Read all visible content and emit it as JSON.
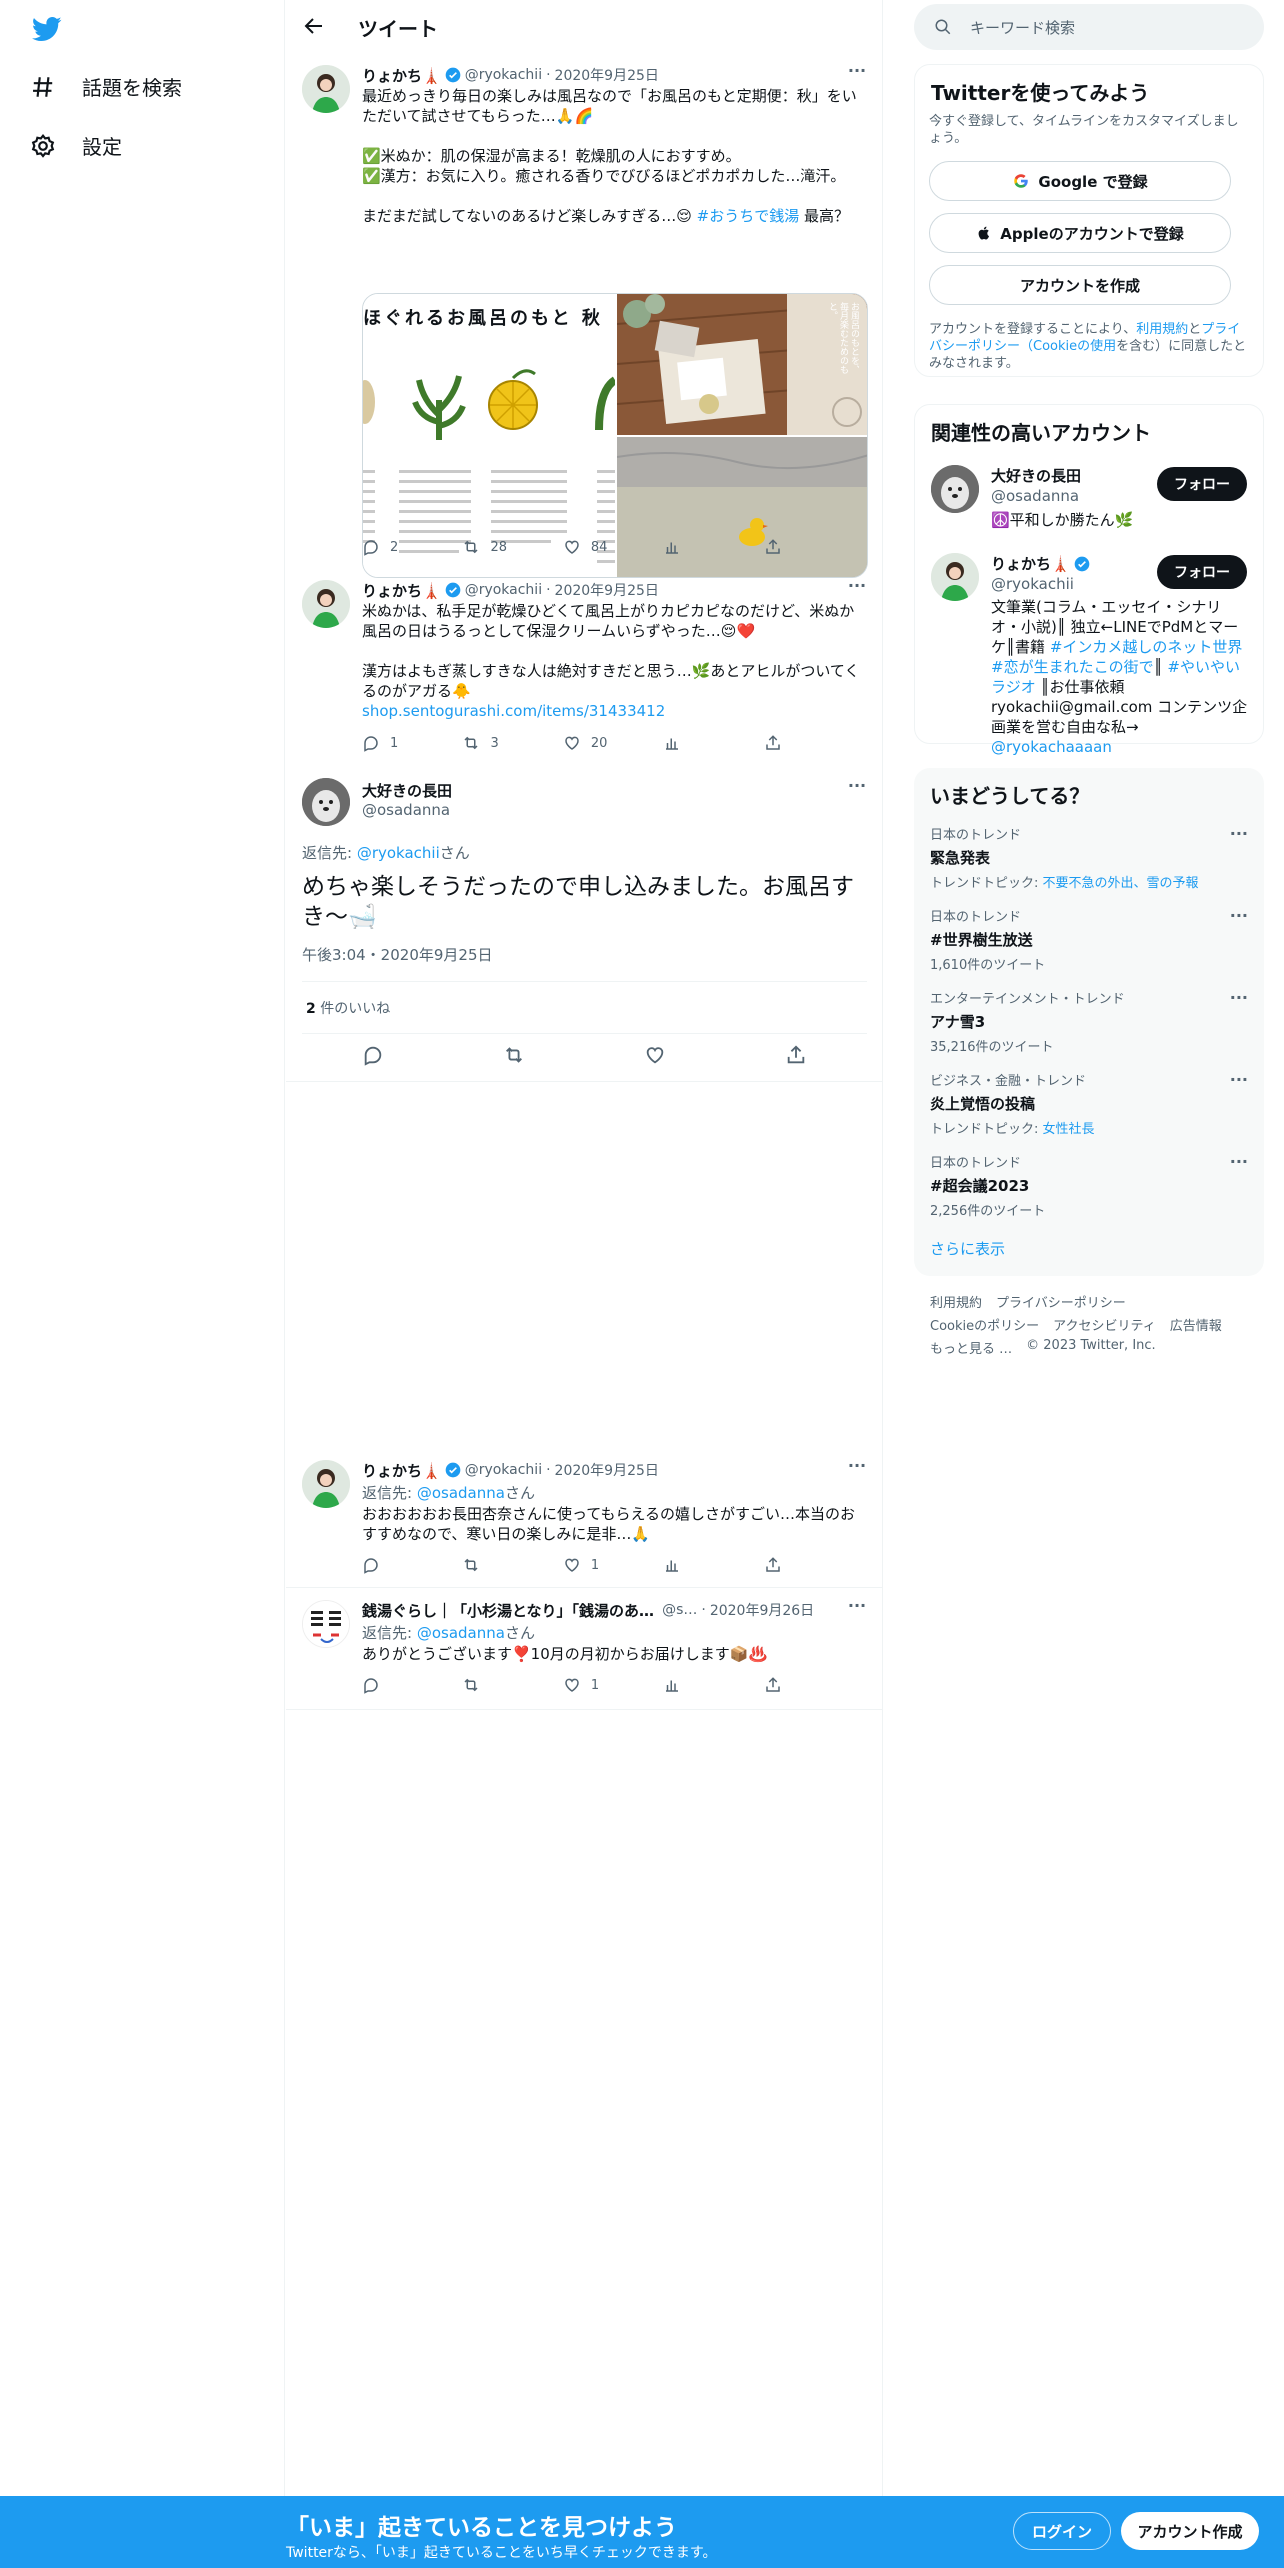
{
  "nav": {
    "items": [
      {
        "label": "話題を検索",
        "icon": "hashtag-icon"
      },
      {
        "label": "設定",
        "icon": "gear-icon"
      }
    ]
  },
  "header": {
    "title": "ツイート"
  },
  "tweets": [
    {
      "name": "りょかち🗼",
      "handle": "@ryokachii",
      "date": "2020年9月25日",
      "text_main": "最近めっきり毎日の楽しみは風呂なので「お風呂のもと定期便：秋」をいただいて試させてもらった…🙏🌈\n\n✅米ぬか：肌の保湿が高まる！乾燥肌の人におすすめ。\n✅漢方：お気に入り。癒される香りでびびるほどポカポカした…滝汗。\n\nまだまだ試してないのあるけど楽しみすぎる…😌 ",
      "hashtag": "#おうちで銭湯",
      "text_after": " 最高？",
      "media_title": "ほぐれるお風呂のもと 秋",
      "media_side_text": "お風呂のもとを、毎月楽むためのもと。",
      "replies": "2",
      "retweets": "28",
      "likes": "84"
    },
    {
      "name": "りょかち🗼",
      "handle": "@ryokachii",
      "date": "2020年9月25日",
      "text_main": "米ぬかは、私手足が乾燥ひどくて風呂上がりカピカピなのだけど、米ぬか風呂の日はうるっとして保湿クリームいらずやった…😌❤️\n\n漢方はよもぎ蒸しすきな人は絶対すきだと思う…🌿あとアヒルがついてくるのがアガる🐥",
      "link": "shop.sentogurashi.com/items/31433412",
      "replies": "1",
      "retweets": "3",
      "likes": "20"
    }
  ],
  "focus": {
    "name": "大好きの長田",
    "handle": "@osadanna",
    "reply_prefix": "返信先: ",
    "reply_to": "@ryokachii",
    "reply_suffix": "さん",
    "text": "めちゃ楽しそうだったので申し込みました。お風呂すき〜🛁",
    "timestamp": "午後3:04・2020年9月25日",
    "likes_count": "2",
    "likes_label": " 件のいいね"
  },
  "replies": [
    {
      "name": "りょかち🗼",
      "handle": "@ryokachii",
      "date": "2020年9月25日",
      "reply_prefix": "返信先: ",
      "reply_to": "@osadanna",
      "reply_suffix": "さん",
      "text": "おおおおおお長田杏奈さんに使ってもらえるの嬉しさがすごい…本当のおすすめなので、寒い日の楽しみに是非…🙏",
      "replies": "",
      "retweets": "",
      "likes": "1"
    },
    {
      "name": "銭湯ぐらし｜「小杉湯となり」「銭湯のあ…",
      "handle": "@s…",
      "date": "2020年9月26日",
      "reply_prefix": "返信先: ",
      "reply_to": "@osadanna",
      "reply_suffix": "さん",
      "text": "ありがとうございます❣️10月の月初からお届けします📦♨️",
      "replies": "",
      "retweets": "",
      "likes": "1"
    }
  ],
  "search": {
    "placeholder": "キーワード検索"
  },
  "signup_card": {
    "title": "Twitterを使ってみよう",
    "subtitle": "今すぐ登録して、タイムラインをカスタマイズしましょう。",
    "google": "Google で登録",
    "apple": "Appleのアカウントで登録",
    "create": "アカウントを作成",
    "terms_1": "アカウントを登録することにより、",
    "terms_link1": "利用規約",
    "terms_2": "と",
    "terms_link2": "プライバシーポリシー（Cookieの使用",
    "terms_3": "を含む）に同意したとみなされます。"
  },
  "relevant": {
    "title": "関連性の高いアカウント",
    "follow_label": "フォロー",
    "accounts": [
      {
        "name": "大好きの長田",
        "handle": "@osadanna",
        "bio": "☮️平和しか勝たん🌿"
      },
      {
        "name": "りょかち🗼",
        "handle": "@ryokachii",
        "bio_1": "文筆業(コラム・エッセイ・シナリオ・小説)║ 独立←LINEでPdMとマーケ║書籍 ",
        "bio_link1": "#インカメ越しのネット世界",
        "bio_link2": "#恋が生まれたこの街で",
        "bio_2": "║ ",
        "bio_link3": "#やいやいラジオ",
        "bio_3": " ║お仕事依頼 ryokachii@gmail.com コンテンツ企画業を営む自由な私→ ",
        "bio_link4": "@ryokachaaaan"
      }
    ]
  },
  "trends": {
    "title": "いまどうしてる？",
    "items": [
      {
        "category": "日本のトレンド",
        "name": "緊急発表",
        "sub_prefix": "トレンドトピック: ",
        "sub_link": "不要不急の外出、雪の予報"
      },
      {
        "category": "日本のトレンド",
        "name": "#世界樹生放送",
        "sub": "1,610件のツイート"
      },
      {
        "category": "エンターテインメント・トレンド",
        "name": "アナ雪3",
        "sub": "35,216件のツイート"
      },
      {
        "category": "ビジネス・金融・トレンド",
        "name": "炎上覚悟の投稿",
        "sub_prefix": "トレンドトピック: ",
        "sub_link": "女性社長"
      },
      {
        "category": "日本のトレンド",
        "name": "#超会議2023",
        "sub": "2,256件のツイート"
      }
    ],
    "show_more": "さらに表示"
  },
  "footer": {
    "line1": [
      "利用規約",
      "プライバシーポリシー"
    ],
    "line2": [
      "Cookieのポリシー",
      "アクセシビリティ",
      "広告情報"
    ],
    "more": "もっと見る …",
    "copyright": "© 2023 Twitter, Inc."
  },
  "bottom": {
    "headline": "「いま」起きていることを見つけよう",
    "sub": "Twitterなら、「いま」起きていることをいち早くチェックできます。",
    "login": "ログイン",
    "signup": "アカウント作成"
  },
  "colors": {
    "accent": "#1d9bf0",
    "text": "#0f1419",
    "muted": "#536471"
  }
}
